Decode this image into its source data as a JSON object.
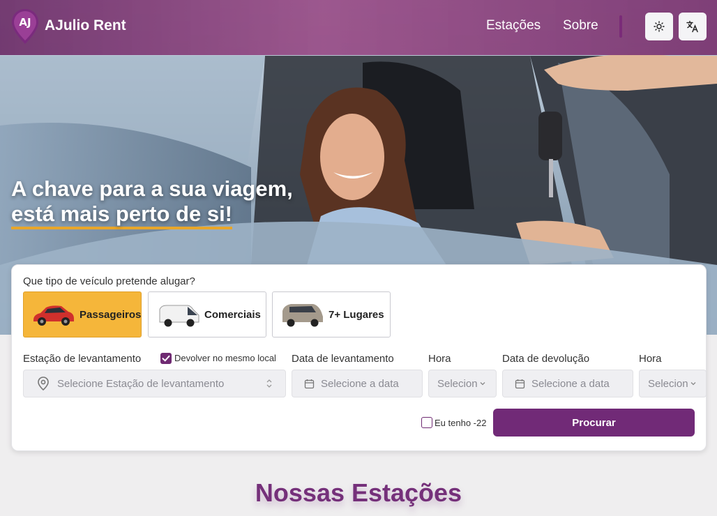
{
  "header": {
    "brand": "AJulio Rent",
    "nav": [
      {
        "label": "Estações"
      },
      {
        "label": "Sobre"
      }
    ],
    "theme_icon": "sun-icon",
    "language_icon": "translate-icon"
  },
  "hero": {
    "headline_line1": "A chave para a sua viagem,",
    "headline_line2": "está mais perto de si!"
  },
  "search": {
    "question": "Que tipo de veículo pretende alugar?",
    "vehicle_types": [
      {
        "label": "Passageiros",
        "icon": "red-car-icon",
        "selected": true
      },
      {
        "label": "Comerciais",
        "icon": "white-van-icon",
        "selected": false
      },
      {
        "label": "7+ Lugares",
        "icon": "minivan-icon",
        "selected": false
      }
    ],
    "pickup_station_label": "Estação de levantamento",
    "same_location_label": "Devolver no mesmo local",
    "same_location_checked": true,
    "pickup_station_placeholder": "Selecione Estação de levantamento",
    "pickup_date_label": "Data de levantamento",
    "pickup_date_placeholder": "Selecione a data",
    "pickup_time_label": "Hora",
    "pickup_time_placeholder": "Selecion",
    "return_date_label": "Data de devolução",
    "return_date_placeholder": "Selecione a data",
    "return_time_label": "Hora",
    "return_time_placeholder": "Selecion",
    "under22_label": "Eu tenho -22",
    "under22_checked": false,
    "submit_label": "Procurar"
  },
  "stations": {
    "title": "Nossas Estações"
  },
  "colors": {
    "primary": "#712a77",
    "accent": "#f5b63a",
    "underline": "#e8a62a"
  }
}
